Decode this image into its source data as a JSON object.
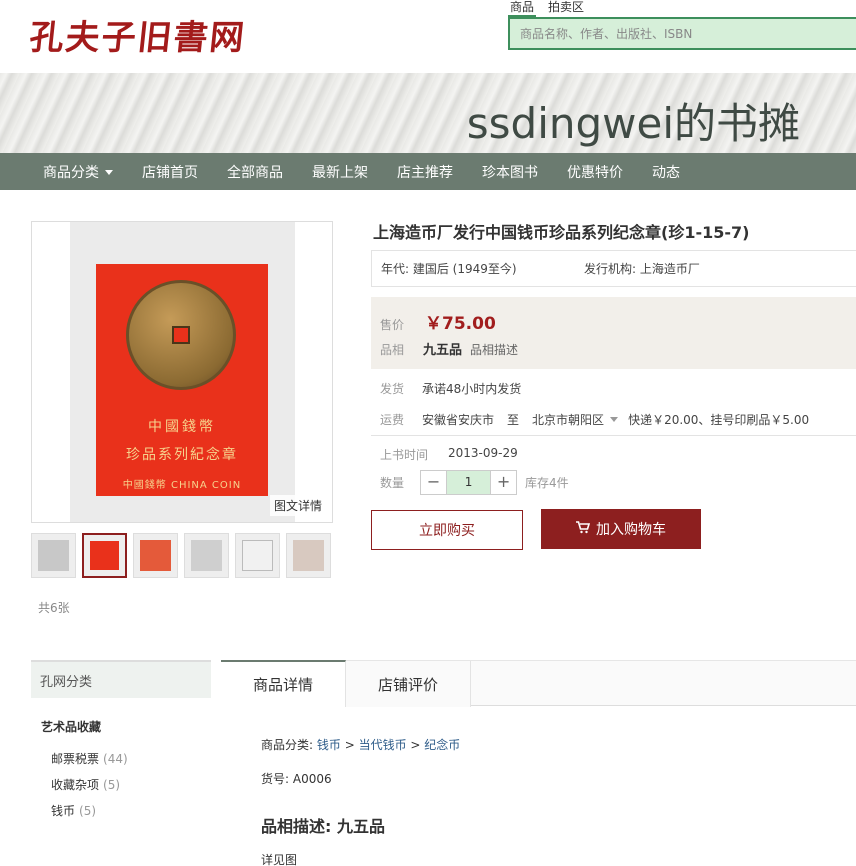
{
  "header": {
    "logo": "孔夫子旧書网",
    "search_tabs": [
      "商品",
      "拍卖区"
    ],
    "search_placeholder": "商品名称、作者、出版社、ISBN"
  },
  "shop": {
    "title": "ssdingwei的书摊"
  },
  "nav": {
    "items": [
      "商品分类",
      "店铺首页",
      "全部商品",
      "最新上架",
      "店主推荐",
      "珍本图书",
      "优惠特价",
      "动态"
    ]
  },
  "gallery": {
    "card_line1": "中國錢幣",
    "card_line2": "珍品系列紀念章",
    "card_line3": "中國錢幣  CHINA COIN",
    "detail_label": "图文详情",
    "count_text": "共6张"
  },
  "product": {
    "title": "上海造币厂发行中国钱币珍品系列纪念章(珍1-15-7)",
    "attr_era": "年代: 建国后 (1949至今)",
    "attr_issuer": "发行机构: 上海造币厂",
    "price_label": "售价",
    "price": "￥75.00",
    "condition_label": "品相",
    "condition": "九五品",
    "condition_link": "品相描述",
    "ship_label": "发货",
    "ship_text": "承诺48小时内发货",
    "fee_label": "运费",
    "fee_from": "安徽省安庆市",
    "fee_to_word": "至",
    "fee_dest": "北京市朝阳区",
    "fee_text": "快递￥20.00、挂号印刷品￥5.00",
    "date_label": "上书时间",
    "date": "2013-09-29",
    "qty_label": "数量",
    "qty_value": "1",
    "stock": "库存4件",
    "buy_label": "立即购买",
    "cart_label": "加入购物车"
  },
  "sidebar": {
    "title": "孔网分类",
    "group": "艺术品收藏",
    "items": [
      {
        "label": "邮票税票",
        "count": "(44)"
      },
      {
        "label": "收藏杂项",
        "count": "(5)"
      },
      {
        "label": "钱币",
        "count": "(5)"
      }
    ]
  },
  "tabs": {
    "items": [
      "商品详情",
      "店铺评价"
    ]
  },
  "detail": {
    "cat_prefix": "商品分类: ",
    "cat_1": "钱币",
    "cat_2": "当代钱币",
    "cat_3": "纪念币",
    "sep": " > ",
    "item_no": "货号: A0006",
    "cond_title": "品相描述: 九五品",
    "see_image": "详见图"
  }
}
